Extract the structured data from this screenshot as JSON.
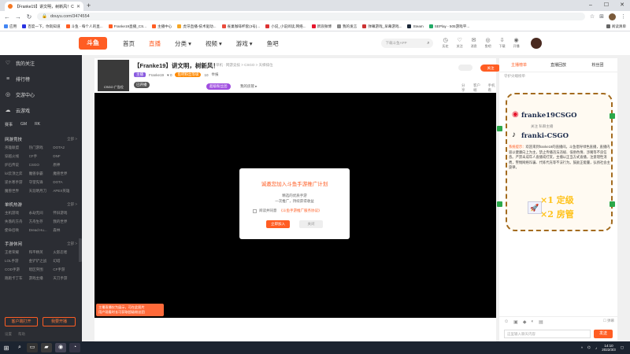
{
  "browser": {
    "tab_title": "【Franke19】讲文明，树新风！CSGO 斗鱼直播",
    "url": "douyu.com/3474554",
    "bookmarks": [
      "应用",
      "百度一下，你就知道",
      "斗鱼 - 每个人的直...",
      "Franke19直播_CS...",
      "主播中心",
      "虎牙直播-技术驱动...",
      "雀巢咖啡杯套(3号)...",
      "小说_小说阅读,网络...",
      "新浪微博",
      "我的发言",
      "弹幕游戏_早幕游戏...",
      "Steam",
      "SEPlay - 505游戏平..."
    ],
    "bookmarks_right": "阅读清单"
  },
  "site": {
    "logo": "斗鱼",
    "nav": [
      "首页",
      "直播",
      "分类",
      "视频",
      "游戏",
      "鱼吧"
    ],
    "nav_active": "直播",
    "search_placeholder": "下载斗鱼APP",
    "header_icons": [
      {
        "icon": "history-icon",
        "label": "历史"
      },
      {
        "icon": "follow-icon",
        "label": "关注"
      },
      {
        "icon": "message-icon",
        "label": "消息"
      },
      {
        "icon": "fishbar-icon",
        "label": "鱼吧"
      },
      {
        "icon": "download-icon",
        "label": "下载"
      },
      {
        "icon": "broadcast-icon",
        "label": "开播"
      }
    ]
  },
  "sidebar": {
    "items": [
      {
        "icon": "heart-icon",
        "label": "我的关注"
      },
      {
        "icon": "rank-icon",
        "label": "排行榜"
      },
      {
        "icon": "voice-icon",
        "label": "交游中心"
      },
      {
        "icon": "cloud-icon",
        "label": "云游戏"
      }
    ],
    "event_row": [
      "赛事",
      "GM",
      "RK"
    ],
    "sections": [
      {
        "title": "网游竞技",
        "more": "全部 >",
        "items": [
          "英雄联盟",
          "热门游戏",
          "DOTA2",
          "穿越火线",
          "CF手",
          "DNF",
          "炉石传说",
          "CSGO",
          "原神",
          "lol云顶之弈",
          "魔兽争霸",
          "魔兽世界",
          "逆水寒手游",
          "守望先锋",
          "DOTA",
          "魔兽世界",
          "天涯明月刀",
          "APEX英雄"
        ]
      },
      {
        "title": "单机热游",
        "more": "全部 >",
        "items": [
          "主机游戏",
          "永劫无间",
          "怀旧游戏",
          "失落的方舟",
          "方舟生存",
          "我的世界",
          "使命召唤",
          "Dread Hu...",
          "森林"
        ]
      },
      {
        "title": "手游休闲",
        "more": "全部 >",
        "items": [
          "王者荣耀",
          "和平精英",
          "火影忍者",
          "LOL手游",
          "金铲铲之战",
          "幻塔",
          "COD手游",
          "暗区突围",
          "CF手游",
          "跑跑卡丁车",
          "游戏主播",
          "天刀手游"
        ]
      }
    ],
    "buttons": [
      "客户端打开",
      "我要开播"
    ],
    "footer": [
      "设置",
      "帮助"
    ]
  },
  "room": {
    "title": "【Franke19】讲文明，树新风！",
    "category": "单机 · 网游竞技 > CSGO > 天梯排位",
    "tag": "主播",
    "streamer": "Franke19",
    "fans": "0",
    "level_badge": "鱼吧粉丝等级",
    "extra": "10",
    "report": "举报",
    "avatar_caption": "CSGO 广告位",
    "live_status": "已开播",
    "pill": "超级粉丝团",
    "my_label": "我的房管",
    "follow_label": "关注",
    "tools": [
      "分享",
      "客户端",
      "手机看"
    ]
  },
  "modal": {
    "title": "诚邀您加入斗鱼手游推广计划",
    "line1": "精选的优质手游",
    "line2": "一次推广，持续获得收益",
    "agree_prefix": "阅读并同意",
    "agree_link": "《斗鱼手游推广服务协议》",
    "confirm": "立即加入",
    "cancel": "关闭"
  },
  "overlay_tip": {
    "line1": "主播直播仅为展示，可在此图片",
    "line2": "用户观看时长可获取超级粉丝团"
  },
  "rpanel": {
    "tabs": [
      "主播榜单",
      "直播回放",
      "粉丝团"
    ],
    "sub": "守护尖端榜单",
    "promo_lines": [
      "franke19CSGO",
      "关注 私聊主播",
      "franki-CSGO"
    ],
    "chat_name": "系统提示：",
    "chat_text": "欢迎来到franke19的直播间。斗鱼倡导绿色直播，直播内容以健康向上为主，禁止传播违法违规、低俗色情、涉赌等不良信息。严禁未成年人直播或打赏。主播以正当方式直播，注意理性消费，警惕网络诈骗、代练代充等不法行为。鼓励正能量，弘扬社会主旋律。",
    "big1": "×1 定级",
    "big2": "×2 房管",
    "input_placeholder": "这里输入聊天内容",
    "send": "发送",
    "flags": "☐ 弹幕"
  },
  "taskbar": {
    "time": "14:10",
    "date": "2022/3/3"
  }
}
